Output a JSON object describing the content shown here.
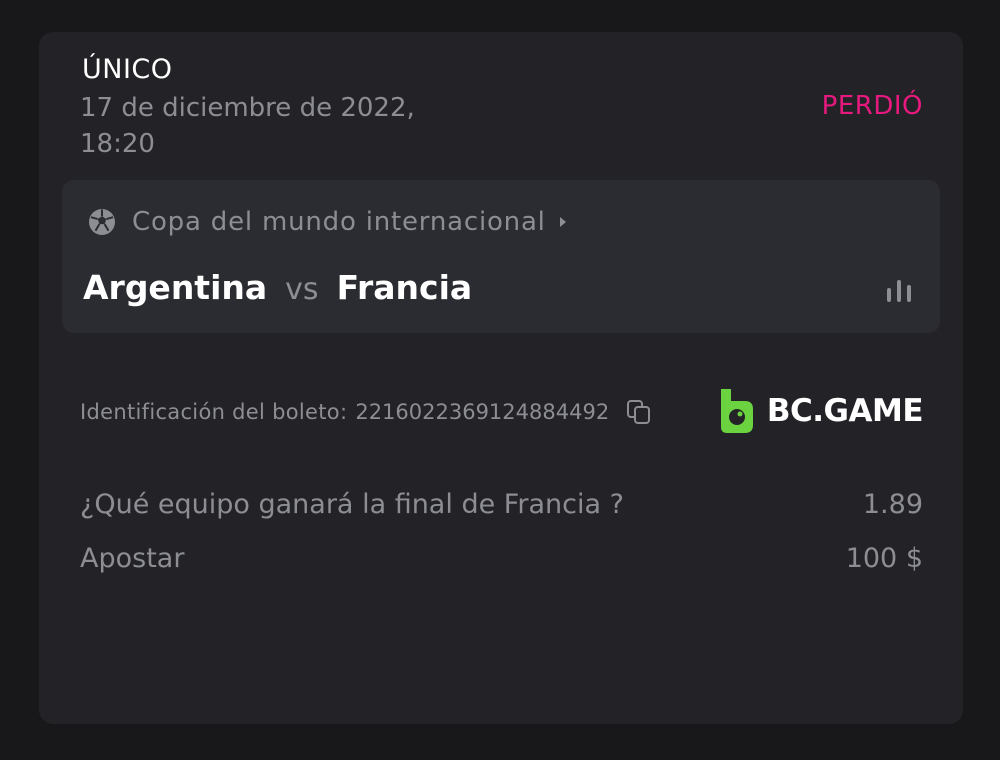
{
  "bet": {
    "type": "ÚNICO",
    "date": "17 de diciembre de 2022, 18:20",
    "status": "PERDIÓ",
    "status_color": "#e6197e"
  },
  "match": {
    "league_icon": "soccer-ball-icon",
    "league": "Copa del mundo internacional",
    "team_home": "Argentina",
    "vs": "vs",
    "team_away": "Francia",
    "stats_icon": "bar-chart-icon"
  },
  "ticket": {
    "label": "Identificación del boleto:",
    "id": "2216022369124884492",
    "copy_icon": "copy-icon"
  },
  "brand": {
    "name": "BC.GAME",
    "icon": "bc-game-logo-icon",
    "accent": "#6bd33f"
  },
  "selection": {
    "question": "¿Qué equipo ganará la final de Francia ?",
    "odds": "1.89",
    "stake_label": "Apostar",
    "stake_value": "100 $"
  }
}
